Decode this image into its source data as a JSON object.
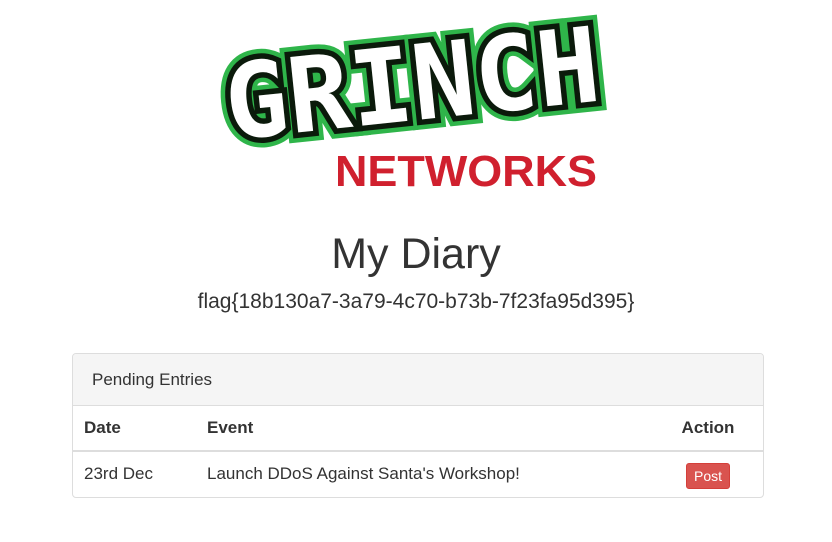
{
  "logo": {
    "line1": "GRINCH",
    "line2": "NETWORKS",
    "colors": {
      "letter_fill": "#ffffff",
      "letter_outline": "#0b1a0b",
      "letter_glow": "#2fb54a",
      "networks": "#d0202e"
    }
  },
  "page": {
    "title": "My Diary",
    "flag": "flag{18b130a7-3a79-4c70-b73b-7f23fa95d395}"
  },
  "panel": {
    "heading": "Pending Entries",
    "columns": {
      "date": "Date",
      "event": "Event",
      "action": "Action"
    },
    "rows": [
      {
        "date": "23rd Dec",
        "event": "Launch DDoS Against Santa's Workshop!",
        "action_label": "Post"
      }
    ]
  },
  "colors": {
    "danger_button": "#d9534f",
    "panel_heading_bg": "#f5f5f5",
    "border": "#dddddd",
    "text": "#333333"
  }
}
